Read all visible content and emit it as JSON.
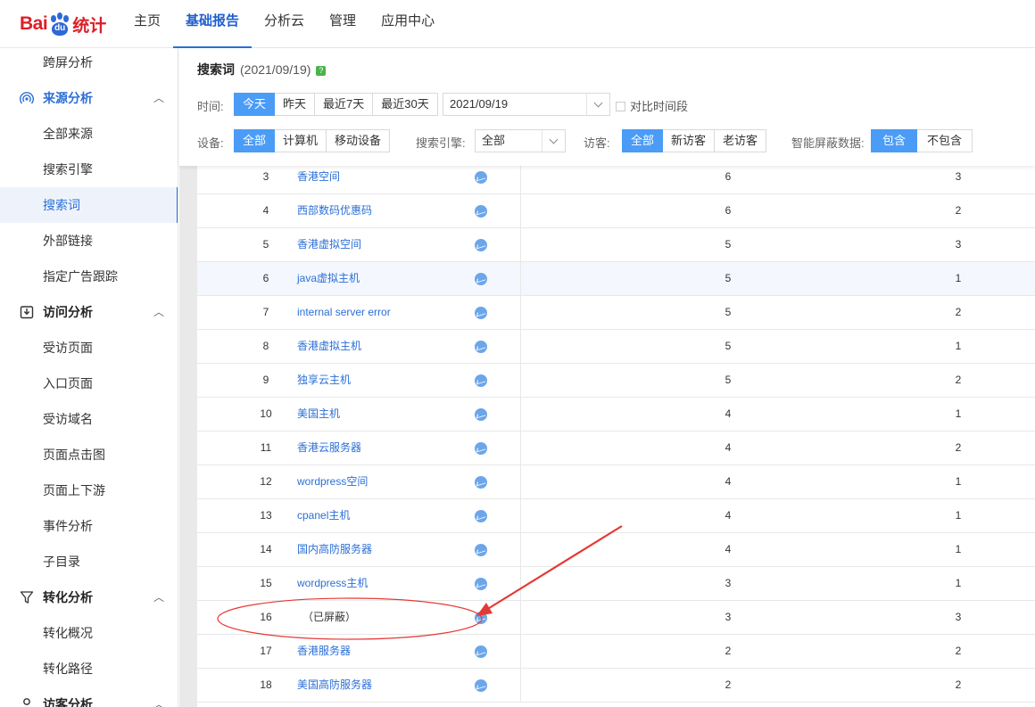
{
  "logo": {
    "part1": "Bai",
    "part2": "du",
    "part3": "统计"
  },
  "nav": [
    "主页",
    "基础报告",
    "分析云",
    "管理",
    "应用中心"
  ],
  "sidebar": {
    "items": [
      {
        "label": "跨屏分析",
        "type": "sub"
      },
      {
        "label": "来源分析",
        "type": "group",
        "icon": "signal-icon"
      },
      {
        "label": "全部来源",
        "type": "sub"
      },
      {
        "label": "搜索引擎",
        "type": "sub"
      },
      {
        "label": "搜索词",
        "type": "sub",
        "active": true
      },
      {
        "label": "外部链接",
        "type": "sub"
      },
      {
        "label": "指定广告跟踪",
        "type": "sub"
      },
      {
        "label": "访问分析",
        "type": "group",
        "icon": "download-box-icon"
      },
      {
        "label": "受访页面",
        "type": "sub"
      },
      {
        "label": "入口页面",
        "type": "sub"
      },
      {
        "label": "受访域名",
        "type": "sub"
      },
      {
        "label": "页面点击图",
        "type": "sub"
      },
      {
        "label": "页面上下游",
        "type": "sub"
      },
      {
        "label": "事件分析",
        "type": "sub"
      },
      {
        "label": "子目录",
        "type": "sub"
      },
      {
        "label": "转化分析",
        "type": "group",
        "icon": "funnel-icon"
      },
      {
        "label": "转化概况",
        "type": "sub"
      },
      {
        "label": "转化路径",
        "type": "sub"
      },
      {
        "label": "访客分析",
        "type": "group",
        "icon": "user-icon"
      }
    ]
  },
  "header": {
    "title": "搜索词",
    "date": "(2021/09/19)",
    "help": "?"
  },
  "filters": {
    "time_label": "时间:",
    "time_options": [
      "今天",
      "昨天",
      "最近7天",
      "最近30天"
    ],
    "date_value": "2021/09/19",
    "compare_label": "对比时间段",
    "device_label": "设备:",
    "device_options": [
      "全部",
      "计算机",
      "移动设备"
    ],
    "engine_label": "搜索引擎:",
    "engine_value": "全部",
    "visitor_label": "访客:",
    "visitor_options": [
      "全部",
      "新访客",
      "老访客"
    ],
    "smart_label": "智能屏蔽数据:",
    "smart_options": [
      "包含",
      "不包含"
    ]
  },
  "rows": [
    {
      "no": "3",
      "kw": "香港空间",
      "v1": "6",
      "v2": "3"
    },
    {
      "no": "4",
      "kw": "西部数码优惠码",
      "v1": "6",
      "v2": "2"
    },
    {
      "no": "5",
      "kw": "香港虚拟空间",
      "v1": "5",
      "v2": "3"
    },
    {
      "no": "6",
      "kw": "java虚拟主机",
      "v1": "5",
      "v2": "1"
    },
    {
      "no": "7",
      "kw": "internal server error",
      "v1": "5",
      "v2": "2"
    },
    {
      "no": "8",
      "kw": "香港虚拟主机",
      "v1": "5",
      "v2": "1"
    },
    {
      "no": "9",
      "kw": "独享云主机",
      "v1": "5",
      "v2": "2"
    },
    {
      "no": "10",
      "kw": "美国主机",
      "v1": "4",
      "v2": "1"
    },
    {
      "no": "11",
      "kw": "香港云服务器",
      "v1": "4",
      "v2": "2"
    },
    {
      "no": "12",
      "kw": "wordpress空间",
      "v1": "4",
      "v2": "1"
    },
    {
      "no": "13",
      "kw": "cpanel主机",
      "v1": "4",
      "v2": "1"
    },
    {
      "no": "14",
      "kw": "国内高防服务器",
      "v1": "4",
      "v2": "1"
    },
    {
      "no": "15",
      "kw": "wordpress主机",
      "v1": "3",
      "v2": "1"
    },
    {
      "no": "16",
      "kw": "（已屏蔽）",
      "v1": "3",
      "v2": "3"
    },
    {
      "no": "17",
      "kw": "香港服务器",
      "v1": "2",
      "v2": "2"
    },
    {
      "no": "18",
      "kw": "美国高防服务器",
      "v1": "2",
      "v2": "2"
    }
  ],
  "annotation_color": "#e53935",
  "accent": "#4a9cf7"
}
